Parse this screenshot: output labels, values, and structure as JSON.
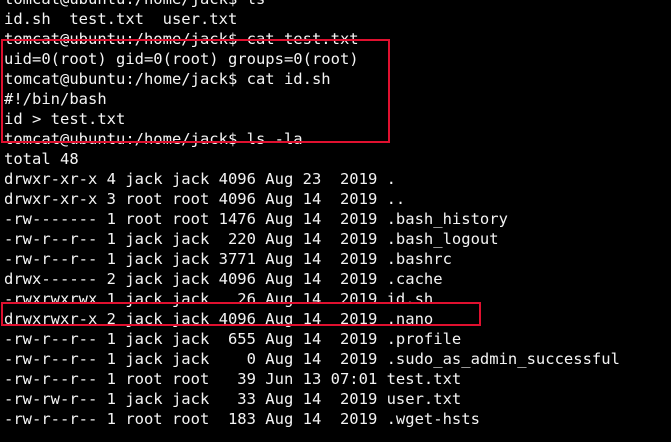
{
  "terminal": {
    "lines": [
      "tomcat@ubuntu:/home/jack$ ls",
      "id.sh  test.txt  user.txt",
      "tomcat@ubuntu:/home/jack$ cat test.txt",
      "uid=0(root) gid=0(root) groups=0(root)",
      "tomcat@ubuntu:/home/jack$ cat id.sh",
      "#!/bin/bash",
      "id > test.txt",
      "tomcat@ubuntu:/home/jack$ ls -la",
      "total 48",
      "drwxr-xr-x 4 jack jack 4096 Aug 23  2019 .",
      "drwxr-xr-x 3 root root 4096 Aug 14  2019 ..",
      "-rw------- 1 root root 1476 Aug 14  2019 .bash_history",
      "-rw-r--r-- 1 jack jack  220 Aug 14  2019 .bash_logout",
      "-rw-r--r-- 1 jack jack 3771 Aug 14  2019 .bashrc",
      "drwx------ 2 jack jack 4096 Aug 14  2019 .cache",
      "-rwxrwxrwx 1 jack jack   26 Aug 14  2019 id.sh",
      "drwxrwxr-x 2 jack jack 4096 Aug 14  2019 .nano",
      "-rw-r--r-- 1 jack jack  655 Aug 14  2019 .profile",
      "-rw-r--r-- 1 jack jack    0 Aug 14  2019 .sudo_as_admin_successful",
      "-rw-r--r-- 1 root root   39 Jun 13 07:01 test.txt",
      "-rw-rw-r-- 1 jack jack   33 Aug 14  2019 user.txt",
      "-rw-r--r-- 1 root root  183 Aug 14  2019 .wget-hsts"
    ]
  },
  "colors": {
    "background": "#000000",
    "text": "#f4f4f4",
    "highlight_box": "#e0102f"
  }
}
